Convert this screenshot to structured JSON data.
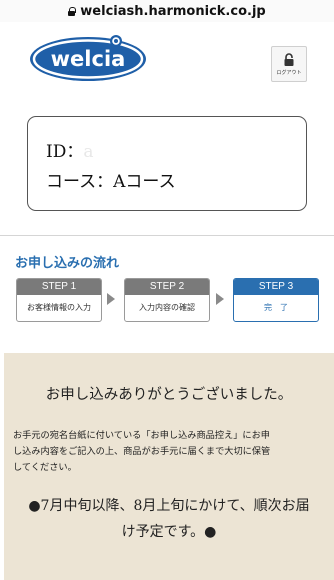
{
  "browser": {
    "url": "welciash.harmonick.co.jp"
  },
  "header": {
    "logo_text": "welcia",
    "logout_label": "ログアウト"
  },
  "account": {
    "id_label": "ID：",
    "id_value": "a",
    "course_label": "コース：",
    "course_value": "Aコース"
  },
  "flow": {
    "title": "お申し込みの流れ",
    "steps": [
      {
        "step": "STEP 1",
        "label": "お客様情報の入力"
      },
      {
        "step": "STEP 2",
        "label": "入力内容の確認"
      },
      {
        "step": "STEP 3",
        "label": "完　了"
      }
    ],
    "active_step": 3
  },
  "thanks": {
    "title": "お申し込みありがとうございました。",
    "note_lines": [
      "お手元の宛名台紙に付いている「お申し込み商品控え」にお申",
      "し込み内容をご記入の上、商品がお手元に届くまで大切に保管",
      "してください。"
    ],
    "schedule_lines": [
      "●7月中旬以降、8月上旬にかけて、順次お届",
      "け予定です。●"
    ]
  },
  "colors": {
    "brand_blue": "#2a6fb0",
    "logo_blue": "#1f5fa8",
    "step_gray": "#7a7a7a",
    "thanks_bg": "#ece4d4"
  }
}
